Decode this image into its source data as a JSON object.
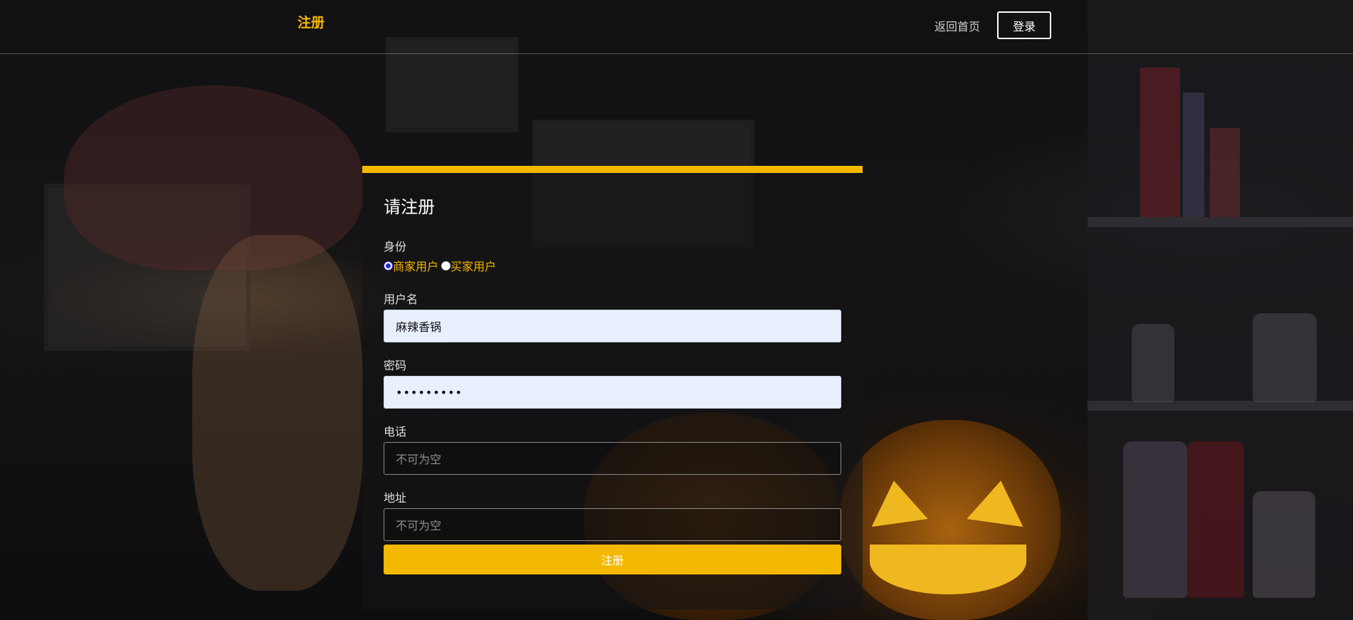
{
  "header": {
    "brand": "注册",
    "home_link": "返回首页",
    "login_button": "登录"
  },
  "form": {
    "title": "请注册",
    "identity": {
      "label": "身份",
      "options": [
        {
          "label": "商家用户",
          "checked": true
        },
        {
          "label": "买家用户",
          "checked": false
        }
      ]
    },
    "username": {
      "label": "用户名",
      "value": "麻辣香锅"
    },
    "password": {
      "label": "密码",
      "value": "•••••••••"
    },
    "phone": {
      "label": "电话",
      "placeholder": "不可为空"
    },
    "address": {
      "label": "地址",
      "placeholder": "不可为空"
    },
    "submit": "注册"
  },
  "colors": {
    "accent": "#f5b800",
    "autofill_bg": "#e8f0fe"
  }
}
